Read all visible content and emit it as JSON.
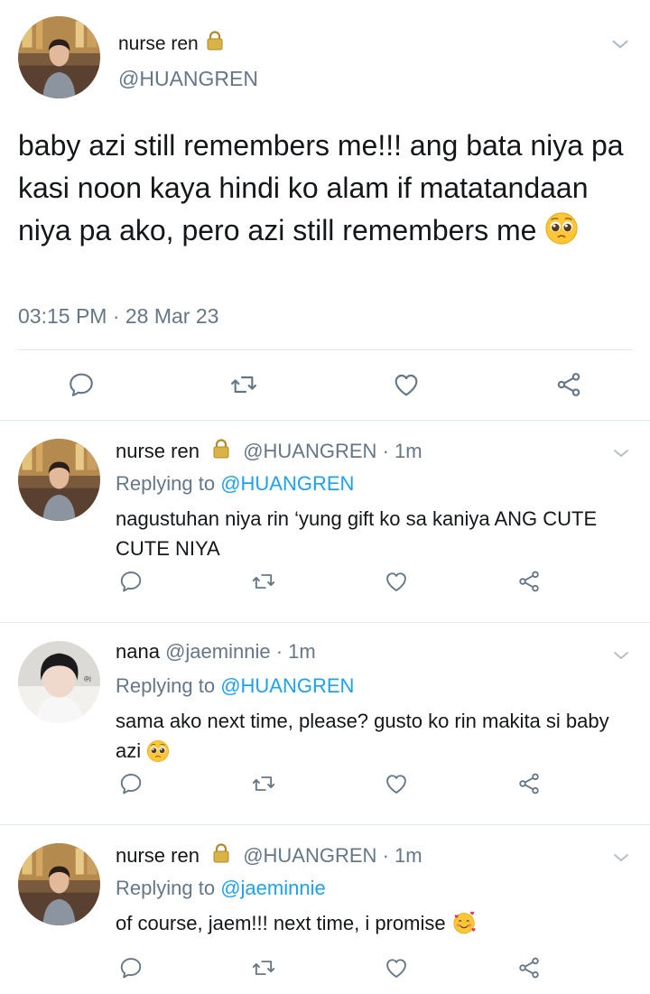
{
  "main": {
    "name": "nurse ren",
    "handle": "@HUANGREN",
    "text": "baby azi still remembers me!!! ang bata niya pa kasi noon kaya hindi ko alam if matatandaan niya pa ako, pero azi still remembers me",
    "timestamp": "03:15 PM · 28 Mar 23"
  },
  "replies": [
    {
      "name": "nurse ren",
      "handle": "@HUANGREN",
      "time": "· 1m",
      "replying_prefix": "Replying to",
      "replying_to": "@HUANGREN",
      "text": "nagustuhan niya rin ‘yung gift ko sa kaniya ANG CUTE CUTE NIYA"
    },
    {
      "name": "nana",
      "handle": "@jaeminnie",
      "time": "· 1m",
      "replying_prefix": "Replying to",
      "replying_to": "@HUANGREN",
      "text": "sama ako next time, please? gusto ko rin makita si baby azi"
    },
    {
      "name": "nurse ren",
      "handle": "@HUANGREN",
      "time": "· 1m",
      "replying_prefix": "Replying to",
      "replying_to": "@jaeminnie",
      "text": "of course, jaem!!! next time, i promise"
    }
  ],
  "icons": {
    "reply": "reply-icon",
    "retweet": "retweet-icon",
    "like": "heart-icon",
    "share": "share-icon",
    "lock": "lock-icon",
    "more": "chevron-down-icon"
  },
  "colors": {
    "accent": "#1da1f2",
    "secondary_text": "#657786",
    "icon": "#657786",
    "divider": "#e1e8ed"
  }
}
